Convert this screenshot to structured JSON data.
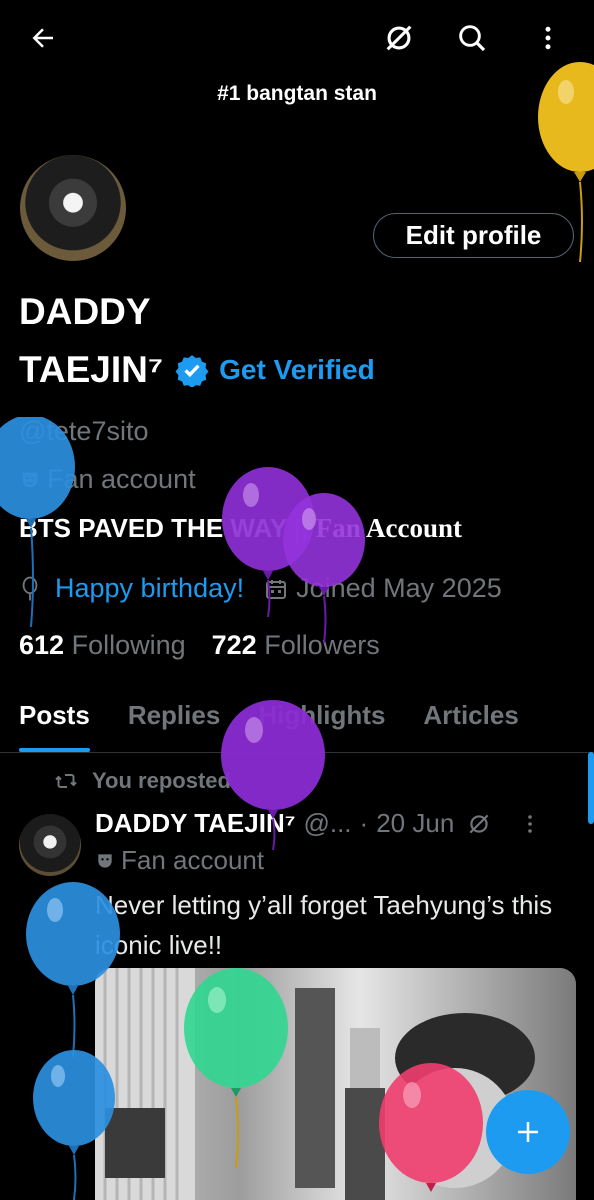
{
  "header": {
    "title": "#1 bangtan stan",
    "back_icon": "arrow-left-icon",
    "grok_icon": "grok-icon",
    "search_icon": "search-icon",
    "more_icon": "more-vertical-icon"
  },
  "profile": {
    "name_line1": "DADDY",
    "name_line2": "TAEJIN⁷",
    "get_verified": "Get Verified",
    "handle": "@tete7sito",
    "account_label": "Fan account",
    "bio_part1": "BTS PAVED THE WAY || ",
    "bio_part2": "Fan Account",
    "birthday": "Happy birthday!",
    "joined": "Joined May 2025",
    "following_count": "612",
    "following_label": "Following",
    "followers_count": "722",
    "followers_label": "Followers",
    "edit_button": "Edit profile"
  },
  "tabs": [
    {
      "label": "Posts"
    },
    {
      "label": "Replies"
    },
    {
      "label": "Highlights"
    },
    {
      "label": "Articles"
    }
  ],
  "post": {
    "repost_label": "You reposted",
    "author_name": "DADDY TAEJIN⁷",
    "author_handle": "@...",
    "separator": "·",
    "date": "20 Jun",
    "account_label": "Fan account",
    "text": "Never letting y’all forget Taehyung’s this iconic live!!"
  },
  "colors": {
    "accent": "#1d9bf0",
    "background": "#000000",
    "muted": "#71767b"
  },
  "balloons": [
    "yellow-balloon",
    "blue-balloon",
    "purple-balloon",
    "purple-balloon",
    "purple-balloon",
    "blue-balloon",
    "blue-balloon",
    "green-balloon",
    "pink-balloon"
  ]
}
